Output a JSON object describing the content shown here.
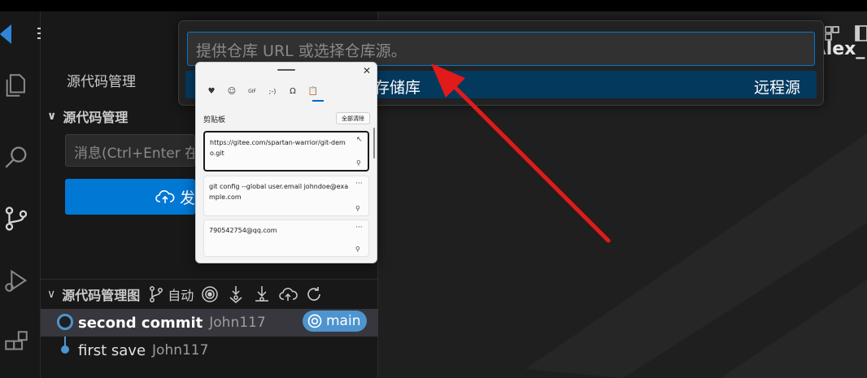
{
  "sidebar": {
    "title": "源代码管理",
    "section_title": "源代码管理",
    "message_placeholder": "消息(Ctrl+Enter 在",
    "commit_button_label": "发"
  },
  "graph": {
    "title": "源代码管理图",
    "auto_label": "自动",
    "commits": [
      {
        "message": "second commit",
        "author": "John117"
      },
      {
        "message": "first save",
        "author": "John117"
      }
    ],
    "branch": "main"
  },
  "quick_pick": {
    "input_placeholder": "提供仓库 URL 或选择仓库源。",
    "item_label": "存储库",
    "item_detail": "远程源"
  },
  "watermark": "HDAlex_",
  "clipboard": {
    "header": "剪贴板",
    "clear_all": "全部清除",
    "tabs": [
      "♥",
      "☺",
      "GIF",
      ";-)",
      "Ω",
      "📋"
    ],
    "items": [
      {
        "text": "https://gitee.com/spartan-warrior/git-demo.git"
      },
      {
        "text": "git config --global user.email johndoe@example.com"
      },
      {
        "text": "790542754@qq.com"
      }
    ]
  },
  "colors": {
    "accent": "#0078d4",
    "annotation_arrow": "#e21a1a",
    "branch_badge": "#4e94ce"
  }
}
